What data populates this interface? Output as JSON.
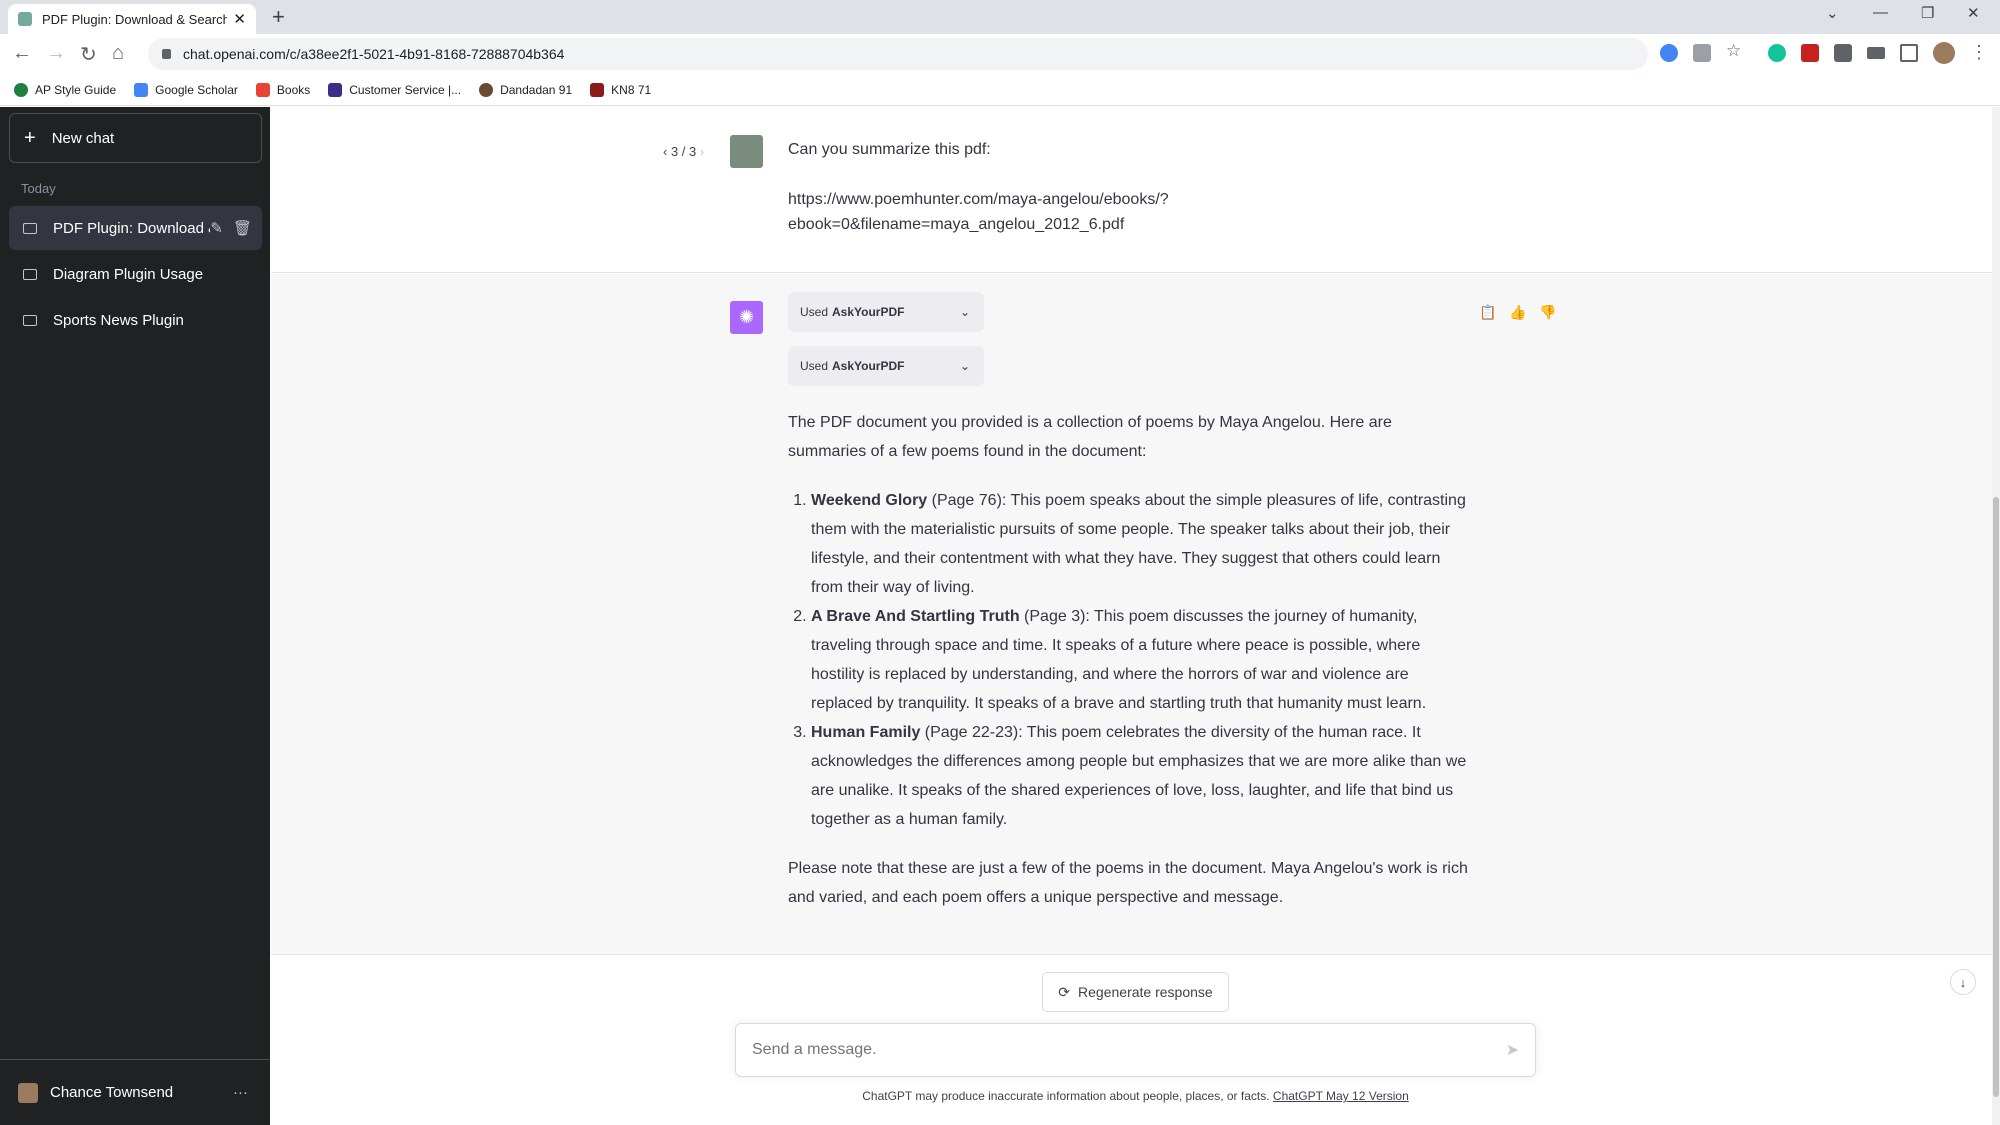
{
  "browser": {
    "tab_title": "PDF Plugin: Download & Search",
    "tab_close": "✕",
    "new_tab": "+",
    "url": "chat.openai.com/c/a38ee2f1-5021-4b91-8168-72888704b364",
    "bookmarks": [
      "AP Style Guide",
      "Google Scholar",
      "Books",
      "Customer Service |...",
      "Dandadan 91",
      "KN8 71"
    ]
  },
  "sidebar": {
    "new_chat": "New chat",
    "section": "Today",
    "items": [
      {
        "label": "PDF Plugin: Download & Search"
      },
      {
        "label": "Diagram Plugin Usage"
      },
      {
        "label": "Sports News Plugin"
      }
    ],
    "user_name": "Chance Townsend",
    "more": "···"
  },
  "conversation": {
    "pager": "3 / 3",
    "user_message_line1": "Can you summarize this pdf:",
    "user_message_url_1": "https://www.poemhunter.com/maya-angelou/ebooks/?",
    "user_message_url_2": "ebook=0&filename=maya_angelou_2012_6.pdf",
    "plugin_used_prefix": "Used",
    "plugin_name": "AskYourPDF",
    "answer_intro": "The PDF document you provided is a collection of poems by Maya Angelou. Here are summaries of a few poems found in the document:",
    "poems": [
      {
        "title": "Weekend Glory",
        "text": " (Page 76): This poem speaks about the simple pleasures of life, contrasting them with the materialistic pursuits of some people. The speaker talks about their job, their lifestyle, and their contentment with what they have. They suggest that others could learn from their way of living."
      },
      {
        "title": "A Brave And Startling Truth",
        "text": " (Page 3): This poem discusses the journey of humanity, traveling through space and time. It speaks of a future where peace is possible, where hostility is replaced by understanding, and where the horrors of war and violence are replaced by tranquility. It speaks of a brave and startling truth that humanity must learn."
      },
      {
        "title": "Human Family",
        "text": " (Page 22-23): This poem celebrates the diversity of the human race. It acknowledges the differences among people but emphasizes that we are more alike than we are unalike. It speaks of the shared experiences of love, loss, laughter, and life that bind us together as a human family."
      }
    ],
    "answer_outro": "Please note that these are just a few of the poems in the document. Maya Angelou's work is rich and varied, and each poem offers a unique perspective and message."
  },
  "composer": {
    "regenerate": "Regenerate response",
    "placeholder": "Send a message.",
    "disclaimer": "ChatGPT may produce inaccurate information about people, places, or facts.",
    "version_link": "ChatGPT May 12 Version"
  },
  "colors": {
    "sidebar_bg": "#202123",
    "assistant_bg": "#f7f7f8",
    "gpt_logo": "#ab68ff"
  }
}
